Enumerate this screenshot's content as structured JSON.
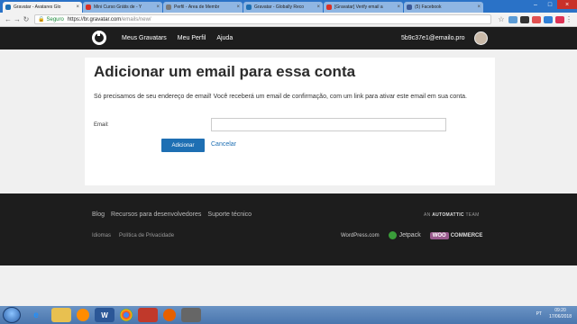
{
  "browser": {
    "tabs": [
      {
        "label": "Gravatar - Avatares Glo",
        "color": "#1e6fb3",
        "active": true
      },
      {
        "label": "Mini Curso Grátis de - Y",
        "color": "#d93025",
        "active": false
      },
      {
        "label": "Perfil - Área de Membr",
        "color": "#7a7a7a",
        "active": false
      },
      {
        "label": "Gravatar - Globally Reco",
        "color": "#1e6fb3",
        "active": false
      },
      {
        "label": "[Gravatar] Verify email a",
        "color": "#d93025",
        "active": false
      },
      {
        "label": "(5) Facebook",
        "color": "#3b5998",
        "active": false
      }
    ],
    "secure_label": "Seguro",
    "url_host": "https://br.gravatar.com",
    "url_path": "/emails/new/"
  },
  "site": {
    "nav": [
      "Meus Gravatars",
      "Meu Perfil",
      "Ajuda"
    ],
    "user_email": "5b9c37e1@emailo.pro"
  },
  "card": {
    "title": "Adicionar um email para essa conta",
    "description": "Só precisamos de seu endereço de email! Você receberá um email de confirmação, com um link para ativar este email em sua conta.",
    "email_label": "Email:",
    "email_value": "",
    "add_label": "Adicionar",
    "cancel_label": "Cancelar"
  },
  "footer": {
    "links": [
      "Blog",
      "Recursos para desenvolvedores",
      "Suporte técnico"
    ],
    "links2": [
      "Idiomas",
      "Política de Privacidade"
    ],
    "an": "AN",
    "automattic": "AUTOMATTIC",
    "team": "TEAM",
    "wordpress": "WordPress.com",
    "jetpack": "Jetpack",
    "woo": "WOO",
    "commerce": "COMMERCE"
  },
  "taskbar": {
    "lang": "PT",
    "time": "09:20",
    "date": "17/06/2018"
  }
}
